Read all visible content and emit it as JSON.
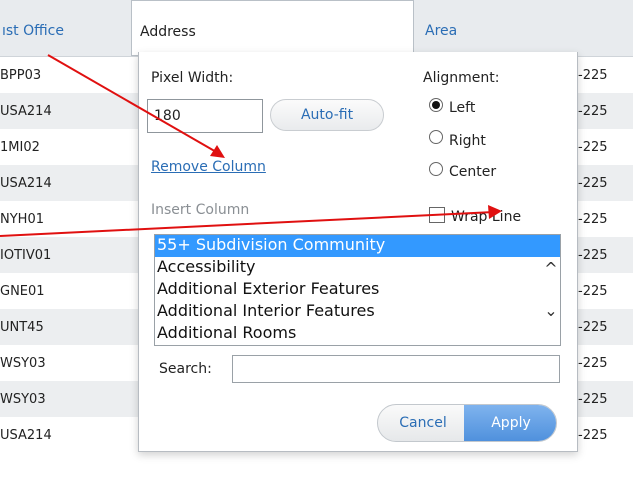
{
  "grid": {
    "headers": {
      "post_office": "ıst Office",
      "address": "Address",
      "area": "Area"
    },
    "rows": [
      {
        "code": "BPP03",
        "area": "-225"
      },
      {
        "code": "USA214",
        "area": "-225"
      },
      {
        "code": "1MI02",
        "area": "-225"
      },
      {
        "code": "USA214",
        "area": "-225"
      },
      {
        "code": "NYH01",
        "area": "-225"
      },
      {
        "code": "IOTIV01",
        "area": "-225"
      },
      {
        "code": "GNE01",
        "area": "-225"
      },
      {
        "code": "UNT45",
        "area": "-225"
      },
      {
        "code": "WSY03",
        "area": "-225"
      },
      {
        "code": "WSY03",
        "area": "-225"
      },
      {
        "code": "USA214",
        "area": "-225"
      }
    ]
  },
  "dialog": {
    "pixel_width_label": "Pixel Width:",
    "pixel_width_value": "180",
    "autofit_label": "Auto-fit",
    "remove_column_label": "Remove Column",
    "alignment_label": "Alignment:",
    "alignment_options": [
      "Left",
      "Right",
      "Center"
    ],
    "alignment_selected": "Left",
    "wrap_line_label": "Wrap Line",
    "insert_column_label": "Insert Column",
    "column_list": [
      "55+ Subdivision Community",
      "Accessibility",
      "Additional Exterior Features",
      "Additional Interior Features",
      "Additional Rooms"
    ],
    "scroll_up_glyph": "^",
    "scroll_down_glyph": "⌄",
    "search_label": "Search:",
    "cancel_label": "Cancel",
    "apply_label": "Apply"
  },
  "colors": {
    "link": "#2a6db5",
    "selection": "#3399ff",
    "annotation_arrow": "#e01010",
    "apply": "#4d8fdc"
  }
}
